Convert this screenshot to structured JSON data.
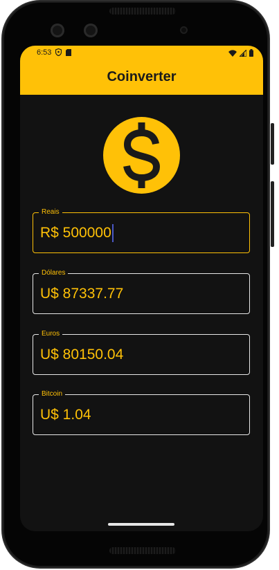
{
  "status": {
    "time": "6:53"
  },
  "app": {
    "title": "Coinverter"
  },
  "colors": {
    "accent": "#FFC107",
    "background": "#121212",
    "border": "#e8e8e8"
  },
  "icons": {
    "logo": "dollar-coin-icon"
  },
  "fields": [
    {
      "label": "Reais",
      "value": "R$ 500000",
      "focused": true
    },
    {
      "label": "Dólares",
      "value": "U$ 87337.77",
      "focused": false
    },
    {
      "label": "Euros",
      "value": "U$ 80150.04",
      "focused": false
    },
    {
      "label": "Bitcoin",
      "value": "U$ 1.04",
      "focused": false
    }
  ]
}
